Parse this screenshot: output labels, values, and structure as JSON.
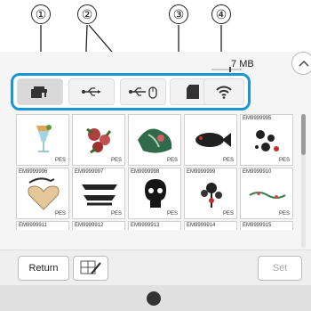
{
  "callouts": [
    "①",
    "②",
    "③",
    "④"
  ],
  "memory": {
    "value": "7",
    "unit": "MB"
  },
  "sources": [
    {
      "name": "machine memory",
      "icon": "sewing-machine-icon",
      "active": true
    },
    {
      "name": "usb port 1",
      "icon": "usb-icon"
    },
    {
      "name": "usb port 2 mouse",
      "icon": "usb-mouse-icon"
    },
    {
      "name": "sd card",
      "icon": "sd-card-icon"
    },
    {
      "name": "wireless",
      "icon": "wifi-icon"
    }
  ],
  "grid": {
    "row1": [
      {
        "caption": "",
        "ext": "PES",
        "icon": "cocktail-glass-icon"
      },
      {
        "caption": "",
        "ext": "PES",
        "icon": "flower-icon"
      },
      {
        "caption": "",
        "ext": "PES",
        "icon": "leaves-icon"
      },
      {
        "caption": "",
        "ext": "PES",
        "icon": "fish-icon"
      },
      {
        "caption": "EM9999995",
        "ext": "PES",
        "icon": "pattern-icon"
      }
    ],
    "row2": [
      {
        "caption": "EM9999996",
        "ext": "PES",
        "icon": "heart-icon"
      },
      {
        "caption": "EM9999997",
        "ext": "PES",
        "icon": "banner-icon"
      },
      {
        "caption": "EM9999998",
        "ext": "PES",
        "icon": "skull-icon"
      },
      {
        "caption": "EM9999999",
        "ext": "PES",
        "icon": "flower-branch-icon"
      },
      {
        "caption": "EM9999910",
        "ext": "PES",
        "icon": "border-icon"
      }
    ],
    "row3": [
      "EM9999911",
      "EM9999912",
      "EM9999913",
      "EM9999914",
      "EM9999915"
    ]
  },
  "buttons": {
    "return": "Return",
    "set": "Set"
  },
  "colors": {
    "accent": "#1a96d6"
  }
}
